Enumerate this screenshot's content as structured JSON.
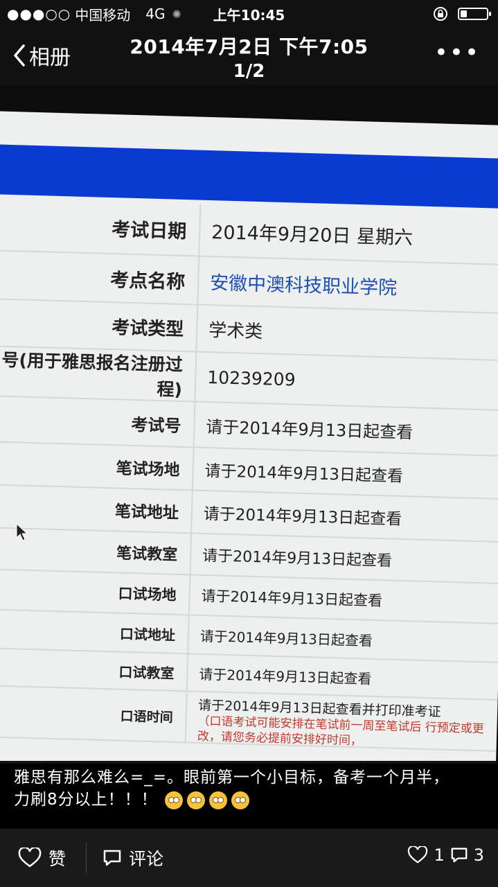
{
  "status_bar": {
    "signal": "●●●○○",
    "carrier": "中国移动",
    "network": "4G",
    "time": "上午10:45",
    "battery_level": 0.25
  },
  "nav": {
    "back_label": "相册",
    "title": "2014年7月2日 下午7:05",
    "subtitle": "1/2",
    "more_label": "•••"
  },
  "exam_table": {
    "rows": [
      {
        "label": "考试日期",
        "value": "2014年9月20日 星期六"
      },
      {
        "label": "考点名称",
        "value": "安徽中澳科技职业学院"
      },
      {
        "label": "考试类型",
        "value": "学术类"
      },
      {
        "label": "号(用于雅思报名注册过程)",
        "value": "10239209"
      },
      {
        "label": "考试号",
        "value": "请于2014年9月13日起查看"
      },
      {
        "label": "笔试场地",
        "value": "请于2014年9月13日起查看"
      },
      {
        "label": "笔试地址",
        "value": "请于2014年9月13日起查看"
      },
      {
        "label": "笔试教室",
        "value": "请于2014年9月13日起查看"
      },
      {
        "label": "口试场地",
        "value": "请于2014年9月13日起查看"
      },
      {
        "label": "口试地址",
        "value": "请于2014年9月13日起查看"
      },
      {
        "label": "口试教室",
        "value": "请于2014年9月13日起查看"
      },
      {
        "label": "口语时间",
        "value": "请于2014年9月13日起查看并打印准考证"
      }
    ],
    "note": "（口语考试可能安排在笔试前一周至笔试后 行预定或更改，请您务必提前安排好时间，",
    "link_color": "#1d4fb0",
    "note_color": "#c0392b"
  },
  "caption": {
    "text": "雅思有那么难么=_=。眼前第一个小目标，备考一个月半，力刷8分以上！！！",
    "emoji_count": 4
  },
  "actions": {
    "like_label": "赞",
    "comment_label": "评论",
    "like_count": "1",
    "comment_count": "3"
  }
}
